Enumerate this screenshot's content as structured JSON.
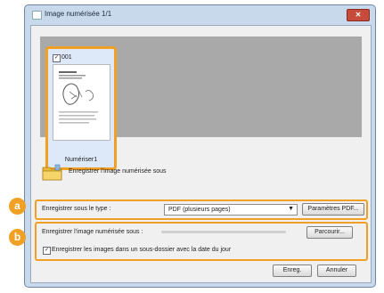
{
  "window": {
    "title": "Image numérisée 1/1",
    "close_glyph": "✕"
  },
  "thumbnail": {
    "checked": "✓",
    "number": "001",
    "label": "Numériser1"
  },
  "save_section": {
    "heading": "Enregistrer l'image numérisée sous"
  },
  "group_a": {
    "badge": "a",
    "type_label": "Enregistrer sous le type :",
    "type_value": "PDF (plusieurs pages)",
    "dropdown_arrow": "▼",
    "pdf_settings_button": "Paramètres PDF..."
  },
  "group_b": {
    "badge": "b",
    "save_as_label": "Enregistrer l'image numérisée sous :",
    "browse_button": "Parcourir...",
    "subfolder_checkbox": "✓",
    "subfolder_label": "Enregistrer les images dans un sous-dossier avec la date du jour"
  },
  "footer": {
    "save_button": "Enreg.",
    "cancel_button": "Annuler"
  },
  "colors": {
    "highlight": "#f0a024",
    "window_frame": "#c9d9ec",
    "preview_bg": "#a9a9a9"
  }
}
